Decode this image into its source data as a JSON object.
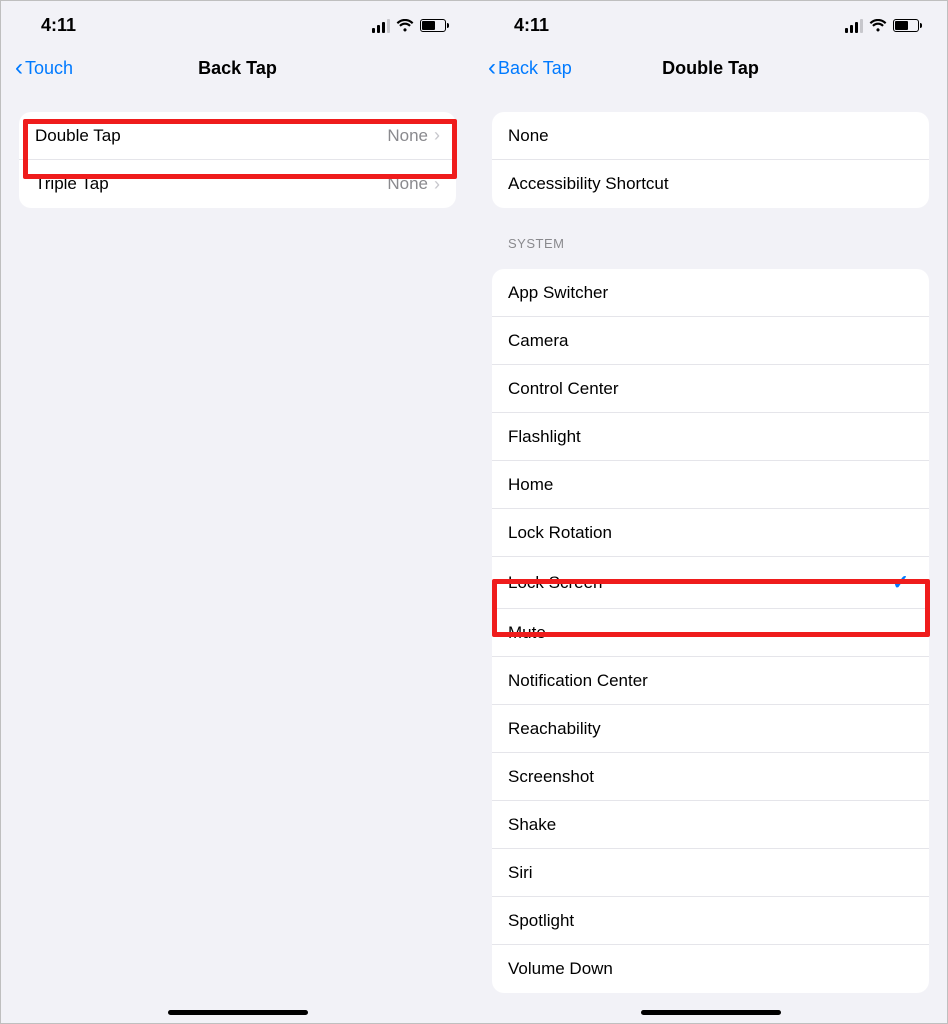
{
  "status": {
    "time": "4:11"
  },
  "left": {
    "back_label": "Touch",
    "title": "Back Tap",
    "rows": [
      {
        "label": "Double Tap",
        "value": "None"
      },
      {
        "label": "Triple Tap",
        "value": "None"
      }
    ]
  },
  "right": {
    "back_label": "Back Tap",
    "title": "Double Tap",
    "top_rows": [
      {
        "label": "None"
      },
      {
        "label": "Accessibility Shortcut"
      }
    ],
    "system_header": "System",
    "system_rows": [
      {
        "label": "App Switcher"
      },
      {
        "label": "Camera"
      },
      {
        "label": "Control Center"
      },
      {
        "label": "Flashlight"
      },
      {
        "label": "Home"
      },
      {
        "label": "Lock Rotation"
      },
      {
        "label": "Lock Screen",
        "checked": true
      },
      {
        "label": "Mute"
      },
      {
        "label": "Notification Center"
      },
      {
        "label": "Reachability"
      },
      {
        "label": "Screenshot"
      },
      {
        "label": "Shake"
      },
      {
        "label": "Siri"
      },
      {
        "label": "Spotlight"
      },
      {
        "label": "Volume Down"
      }
    ]
  }
}
